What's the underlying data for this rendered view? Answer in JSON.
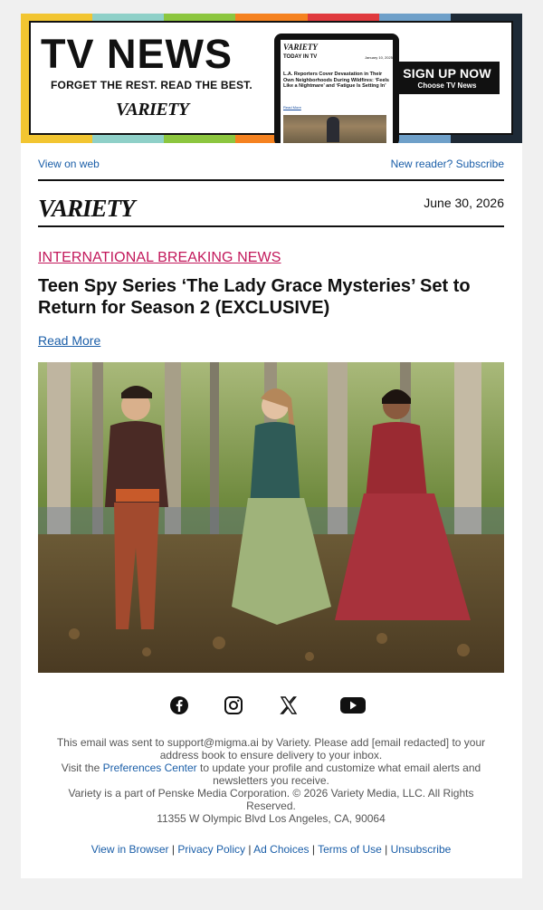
{
  "banner": {
    "headline": "TV NEWS",
    "tagline": "FORGET THE REST. READ THE BEST.",
    "logo_text": "VARIETY",
    "tablet": {
      "logo": "VARIETY",
      "section": "TODAY IN TV",
      "date": "January 10, 2025",
      "story": "L.A. Reporters Cover Devastation in Their Own Neighborhoods During Wildfires: ‘Feels Like a Nightmare’ and ‘Fatigue Is Setting In’",
      "read_more": "Read More"
    },
    "cta_main": "SIGN UP NOW",
    "cta_sub": "Choose TV News",
    "stripe_colors": [
      "#f2c531",
      "#8fd0c8",
      "#8cc63f",
      "#f58220",
      "#e03a3e",
      "#6fa0c9",
      "#1e2a36"
    ]
  },
  "top_links": {
    "view_on_web": "View on web",
    "subscribe": "New reader? Subscribe"
  },
  "header": {
    "logo": "VARIETY",
    "date": "June 30, 2026"
  },
  "article": {
    "category": "INTERNATIONAL BREAKING NEWS",
    "title": "Teen Spy Series ‘The Lady Grace Mysteries’ Set to Return for Season 2 (EXCLUSIVE)",
    "read_more": "Read More"
  },
  "social": {
    "icons": [
      "facebook-icon",
      "instagram-icon",
      "x-icon",
      "youtube-icon"
    ]
  },
  "footer": {
    "line1_pre": "This email was sent to support@migma.ai by Variety. Please add [email redacted] to your address book to ensure delivery to your inbox.",
    "line2_pre": "Visit the ",
    "preferences_link": "Preferences Center",
    "line2_post": " to update your profile and customize what email alerts and newsletters you receive.",
    "line3": "Variety is a part of Penske Media Corporation. © 2026 Variety Media, LLC. All Rights Reserved.",
    "line4": "11355 W Olympic Blvd Los Angeles, CA, 90064",
    "links": {
      "view_in_browser": "View in Browser",
      "privacy": "Privacy Policy",
      "ad_choices": "Ad Choices",
      "terms": "Terms of Use",
      "unsubscribe": "Unsubscribe",
      "separator": "|"
    }
  },
  "colors": {
    "link": "#1a5ea8",
    "category": "#c2185b",
    "page_bg": "#f0f0f0"
  }
}
